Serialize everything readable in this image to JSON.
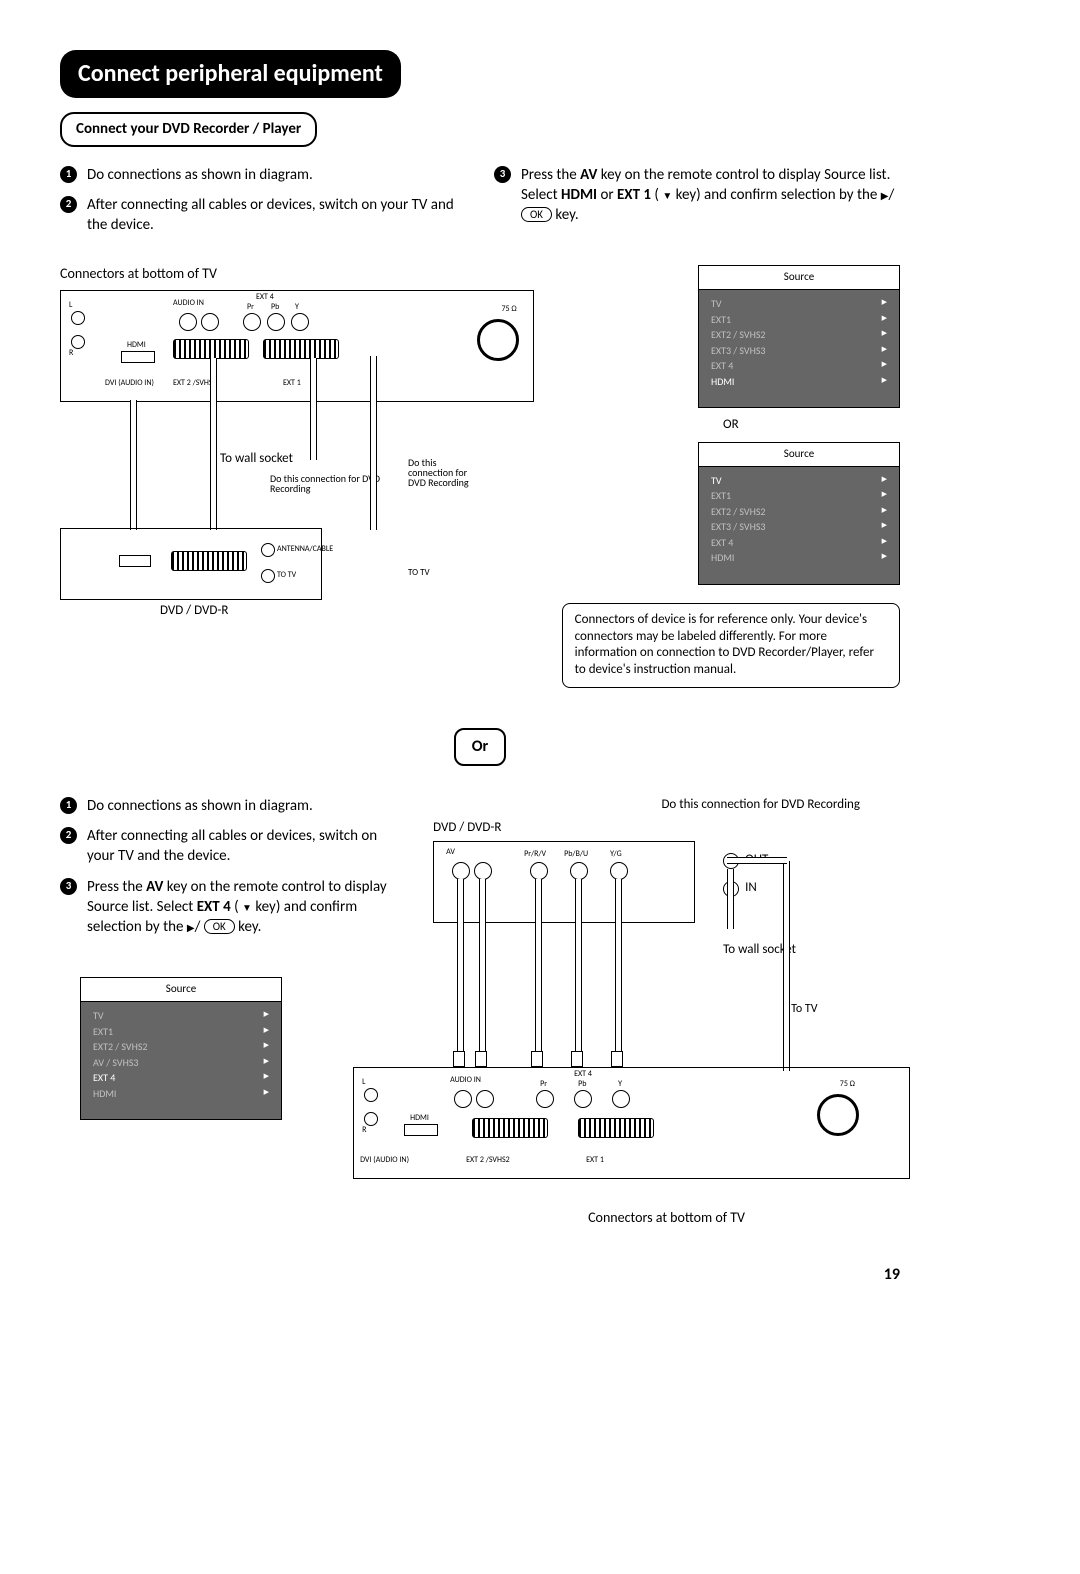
{
  "title": "Connect peripheral equipment",
  "sub_header": "Connect your DVD Recorder / Player",
  "page_number": "19",
  "diagram": {
    "connectors_label": "Connectors at bottom of TV",
    "to_wall": "To wall socket",
    "do_rec": "Do this connection for DVD Recording",
    "do_rec2": "Do this connection for DVD Recording",
    "antenna_cable": "ANTENNA/CABLE",
    "to_tv_small": "TO TV",
    "to_tv_side": "TO TV",
    "dvd_label": "DVD / DVD-R",
    "out": "OUT",
    "in": "IN",
    "to_tv": "To TV",
    "ports": {
      "ext4": "EXT 4",
      "audio_in": "AUDIO IN",
      "r": "R",
      "l": "L",
      "pr": "Pr",
      "pb": "Pb",
      "y": "Y",
      "ohm": "75 Ω",
      "hdmi": "HDMI",
      "dvi": "DVI (AUDIO IN)",
      "ext2": "EXT 2 /SVHS2",
      "ext1": "EXT 1",
      "av": "AV",
      "prrv": "Pr/R/V",
      "pbbu": "Pb/B/U",
      "yg": "Y/G"
    }
  },
  "steps_top_left": [
    "Do connections as shown in diagram.",
    "After connecting all cables or devices, switch on your TV and the device."
  ],
  "step_top_right": {
    "prefix": "Press the ",
    "av": "AV",
    "mid1": " key on the remote control to display Source list. Select ",
    "hdmi": "HDMI",
    "or": " or ",
    "ext1": "EXT 1",
    "mid2": " ( ",
    "mid3": " key) and confirm selection by the ",
    "mid4": "/ ",
    "ok": "OK",
    "end": " key."
  },
  "source_menus": {
    "title": "Source",
    "items": [
      "TV",
      "EXT1",
      "EXT2 / SVHS2",
      "EXT3 / SVHS3",
      "EXT 4",
      "HDMI"
    ],
    "highlight_a": "HDMI",
    "highlight_b": "TV",
    "highlight_c": "EXT 4",
    "items_c": [
      "TV",
      "EXT1",
      "EXT2 / SVHS2",
      "AV / SVHS3",
      "EXT 4",
      "HDMI"
    ]
  },
  "or_label": "OR",
  "big_or": "Or",
  "note_box": "Connectors of device is for reference only. Your device's connectors may be labeled differently. For more information on connection to DVD Recorder/Player, refer to device's instruction manual.",
  "steps_bottom": {
    "s1": "Do connections as shown in diagram.",
    "s2": "After connecting all cables or devices, switch on your TV and the device.",
    "s3_prefix": "Press the ",
    "s3_av": "AV",
    "s3_mid1": " key on the remote control to display Source list. Select ",
    "s3_ext4": "EXT 4",
    "s3_mid2": " ( ",
    "s3_mid3": " key) and confirm selection by the ",
    "s3_mid4": "/ ",
    "s3_ok": "OK",
    "s3_end": " key."
  }
}
